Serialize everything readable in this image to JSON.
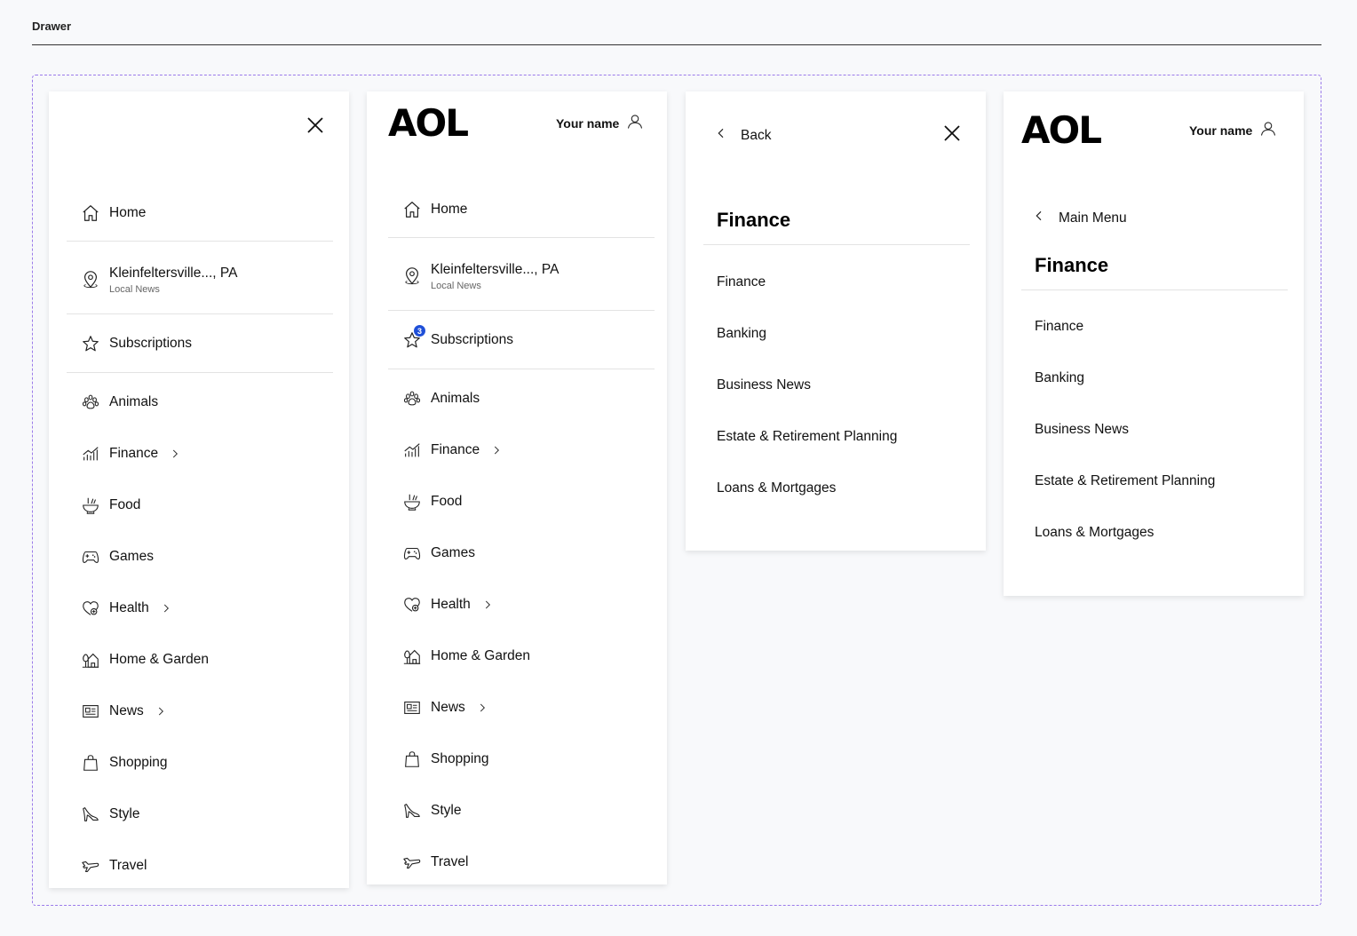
{
  "page": {
    "title": "Drawer"
  },
  "colors": {
    "frame_border": "#9b7bea",
    "badge": "#1f4fd8"
  },
  "header": {
    "logo": "AOL",
    "user_name": "Your name"
  },
  "nav": {
    "home": "Home",
    "location": "Kleinfeltersville..., PA",
    "location_sub": "Local News",
    "subscriptions": "Subscriptions",
    "subscriptions_badge": "3",
    "animals": "Animals",
    "finance": "Finance",
    "food": "Food",
    "games": "Games",
    "health": "Health",
    "home_garden": "Home & Garden",
    "news": "News",
    "shopping": "Shopping",
    "style": "Style",
    "travel": "Travel"
  },
  "submenu": {
    "back_label": "Back",
    "main_menu_label": "Main Menu",
    "title": "Finance",
    "items": [
      "Finance",
      "Banking",
      "Business News",
      "Estate & Retirement Planning",
      "Loans & Mortgages"
    ]
  },
  "icons": [
    "close-icon",
    "home-icon",
    "location-pin-icon",
    "star-icon",
    "paw-icon",
    "chart-icon",
    "bowl-icon",
    "gamepad-icon",
    "heart-plus-icon",
    "house-tree-icon",
    "newspaper-icon",
    "shopping-bag-icon",
    "high-heel-icon",
    "plane-icon",
    "chevron-right-icon",
    "chevron-left-icon",
    "user-icon"
  ]
}
